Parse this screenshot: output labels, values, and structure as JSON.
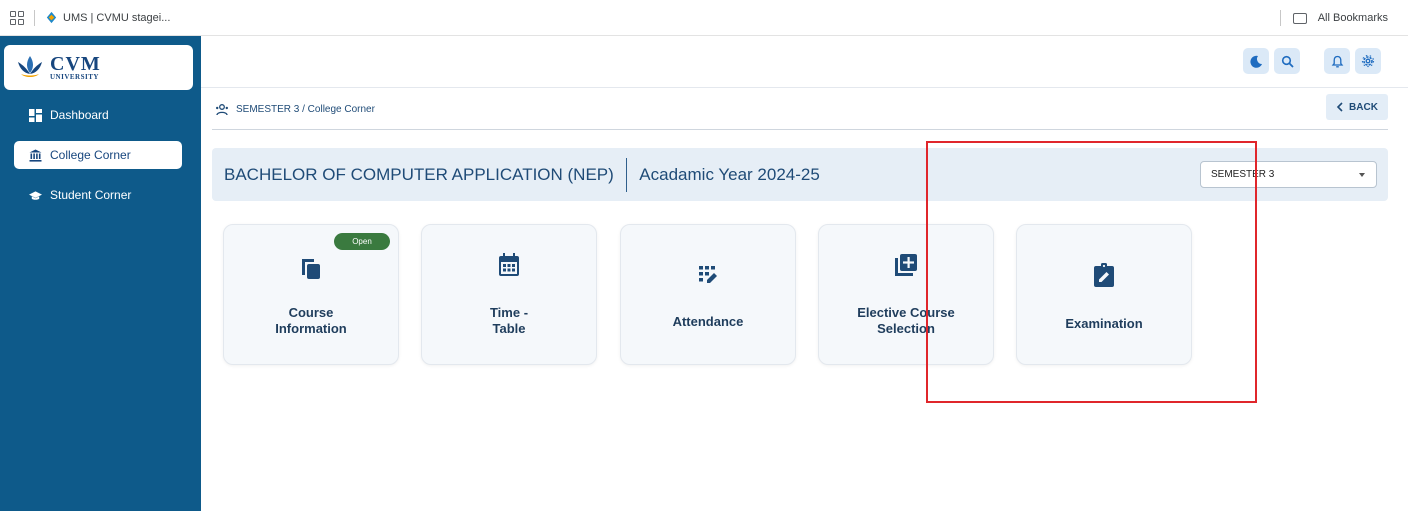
{
  "browser": {
    "tab_title": "UMS | CVMU stagei...",
    "bookmarks_label": "All Bookmarks"
  },
  "sidebar": {
    "logo_main": "CVM",
    "logo_sub": "UNIVERSITY",
    "items": [
      {
        "label": "Dashboard",
        "icon": "dashboard-icon",
        "active": false
      },
      {
        "label": "College Corner",
        "icon": "bank-icon",
        "active": true
      },
      {
        "label": "Student Corner",
        "icon": "graduation-cap-icon",
        "active": false
      }
    ]
  },
  "header": {
    "icons": [
      "moon-icon",
      "search-icon",
      "bell-icon",
      "gear-icon"
    ]
  },
  "breadcrumb": {
    "text": "SEMESTER 3 / College Corner",
    "back_label": "BACK"
  },
  "program": {
    "name": "BACHELOR OF COMPUTER APPLICATION (NEP)",
    "year": "Acadamic Year 2024-25",
    "semester": "SEMESTER 3"
  },
  "cards": [
    {
      "line1": "Course",
      "line2": "Information",
      "icon": "copy-icon",
      "badge": "Open"
    },
    {
      "line1": "Time -",
      "line2": "Table",
      "icon": "calendar-icon"
    },
    {
      "line1": "Attendance",
      "line2": "",
      "icon": "edit-grid-icon"
    },
    {
      "line1": "Elective Course",
      "line2": "Selection",
      "icon": "add-box-icon"
    },
    {
      "line1": "Examination",
      "line2": "",
      "icon": "clipboard-edit-icon"
    }
  ],
  "colors": {
    "sidebar": "#0e5a8a",
    "accent": "#17467e",
    "badge": "#3a7a3f",
    "highlight": "#e0262b"
  }
}
